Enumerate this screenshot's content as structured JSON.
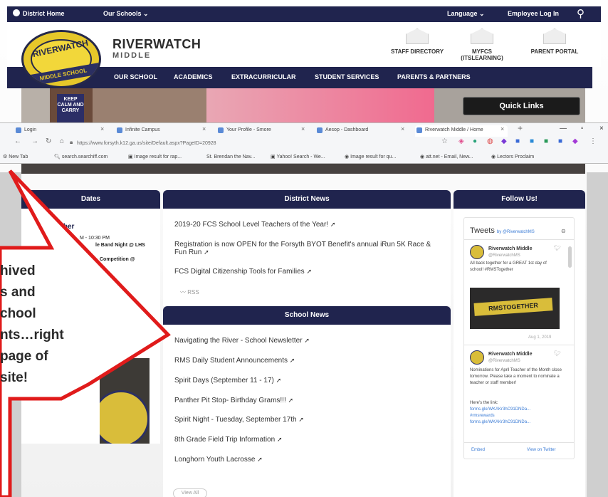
{
  "top_nav": {
    "district_home": "District Home",
    "our_schools": "Our Schools",
    "language": "Language",
    "employee_login": "Employee Log In"
  },
  "header": {
    "school_name": "RIVERWATCH",
    "school_sub": "MIDDLE",
    "logo_top": "RIVERWATCH",
    "logo_bottom": "MIDDLE SCHOOL",
    "icons": [
      {
        "label": "STAFF DIRECTORY"
      },
      {
        "label": "MYFCS (ITSLEARNING)"
      },
      {
        "label": "PARENT PORTAL"
      }
    ]
  },
  "main_nav": [
    "OUR SCHOOL",
    "ACADEMICS",
    "EXTRACURRICULAR",
    "STUDENT SERVICES",
    "PARENTS & PARTNERS"
  ],
  "hero": {
    "sign_text": "KEEP CALM AND CARRY"
  },
  "quick_links": "Quick Links",
  "browser": {
    "tabs": [
      "Login",
      "Infinite Campus",
      "Your Profile - Smore",
      "Aesop - Dashboard",
      "Riverwatch Middle / Home"
    ],
    "url": "https://www.forsyth.k12.ga.us/site/Default.aspx?PageID=20928",
    "bookmarks": [
      "New Tab",
      "search.searchiff.com",
      "Image result for rap...",
      "St. Brendan the Nav...",
      "Yahoo! Search - We...",
      "Image result for qu...",
      "att.net - Email, New...",
      "Lectors Proclaim"
    ]
  },
  "dates": {
    "heading": "Dates",
    "month_partial": "mber",
    "time_partial": "M - 10:30 PM",
    "event1_partial": "le Band Night @ LHS",
    "event2_partial": "Competition @"
  },
  "district_news": {
    "heading": "District News",
    "items": [
      "2019-20 FCS School Level Teachers of the Year!",
      "Registration is now OPEN for the Forsyth BYOT Benefit's annual iRun 5K Race & Fun Run",
      "FCS Digital Citizenship Tools for Families"
    ],
    "rss": "RSS"
  },
  "school_news": {
    "heading": "School News",
    "items": [
      "Navigating the River - School Newsletter",
      "RMS Daily Student Announcements",
      "Spirit Days (September 11 - 17)",
      "Panther Pit Stop- Birthday Grams!!!",
      "Spirit Night - Tuesday, September 17th",
      "8th Grade Field Trip Information",
      "Longhorn Youth Lacrosse"
    ],
    "view_all": "View All"
  },
  "follow": {
    "heading": "Follow Us!",
    "tweets_label": "Tweets",
    "tweets_by": "by @RiverwatchMS",
    "tweet1_name": "Riverwatch Middle",
    "tweet1_handle": "@RiverwatchMS",
    "tweet1_text": "All back together for a GREAT 1st day of school! #RMSTogether",
    "tweet_image_text": "RMSTOGETHER",
    "tweet1_date": "Aug 1, 2019",
    "tweet2_name": "Riverwatch Middle",
    "tweet2_handle": "@RiverwatchMS",
    "tweet2_text": "Nominations for April Teacher of the Month close tomorrow. Please take a moment to nominate a teacher or staff member!",
    "tweet2_here": "Here's the link:",
    "tweet2_link1": "forms.gle/WKAKr3hC91DNDa...",
    "tweet2_link2": "#rmsrewards",
    "tweet2_link3": "forms.gle/WKAKr3hC91DNDa...",
    "embed": "Embed",
    "view_twitter": "View on Twitter"
  },
  "callout": {
    "lines": [
      "hived",
      "s and",
      "chool",
      "nts…right",
      "page of",
      "site!"
    ],
    "border_color": "#e01b1b"
  }
}
